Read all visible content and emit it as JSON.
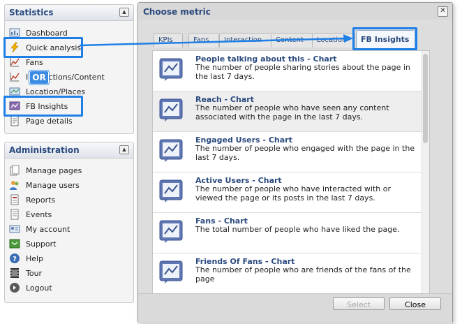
{
  "statistics": {
    "title": "Statistics",
    "items": [
      {
        "label": "Dashboard",
        "icon": "dashboard-icon"
      },
      {
        "label": "Quick analysis",
        "icon": "lightning-icon"
      },
      {
        "label": "Fans",
        "icon": "chart-icon"
      },
      {
        "label": "Interactions/Content",
        "icon": "chart-icon"
      },
      {
        "label": "Location/Places",
        "icon": "map-icon"
      },
      {
        "label": "FB Insights",
        "icon": "insights-icon"
      },
      {
        "label": "Page details",
        "icon": "document-icon"
      }
    ]
  },
  "administration": {
    "title": "Administration",
    "items": [
      {
        "label": "Manage pages",
        "icon": "pages-icon"
      },
      {
        "label": "Manage users",
        "icon": "users-icon"
      },
      {
        "label": "Reports",
        "icon": "report-icon"
      },
      {
        "label": "Events",
        "icon": "events-icon"
      },
      {
        "label": "My account",
        "icon": "account-icon"
      },
      {
        "label": "Support",
        "icon": "support-icon"
      },
      {
        "label": "Help",
        "icon": "help-icon"
      },
      {
        "label": "Tour",
        "icon": "tour-icon"
      },
      {
        "label": "Logout",
        "icon": "logout-icon"
      }
    ]
  },
  "annotation": {
    "or_label": "OR"
  },
  "dialog": {
    "title": "Choose metric",
    "tabs": [
      "KPIs",
      "Fans",
      "Interaction",
      "Content",
      "Location",
      "FB Insights"
    ],
    "active_tab": "FB Insights",
    "metrics": [
      {
        "title": "People talking about this - Chart",
        "desc": "The number of people sharing stories about the page in the last 7 days."
      },
      {
        "title": "Reach - Chart",
        "desc": "The number of people who have seen any content associated with the page in the last 7 days."
      },
      {
        "title": "Engaged Users - Chart",
        "desc": "The number of people who engaged with the page in the last 7 days."
      },
      {
        "title": "Active Users - Chart",
        "desc": "The number of people who have interacted with or viewed the page or its posts in the last 7 days."
      },
      {
        "title": "Fans - Chart",
        "desc": "The total number of people who have liked the page."
      },
      {
        "title": "Friends Of Fans - Chart",
        "desc": "The number of people who are friends of the fans of the page"
      }
    ],
    "select_label": "Select",
    "close_label": "Close"
  },
  "colors": {
    "highlight": "#1e7fe6",
    "title_blue": "#2b4a7e"
  }
}
